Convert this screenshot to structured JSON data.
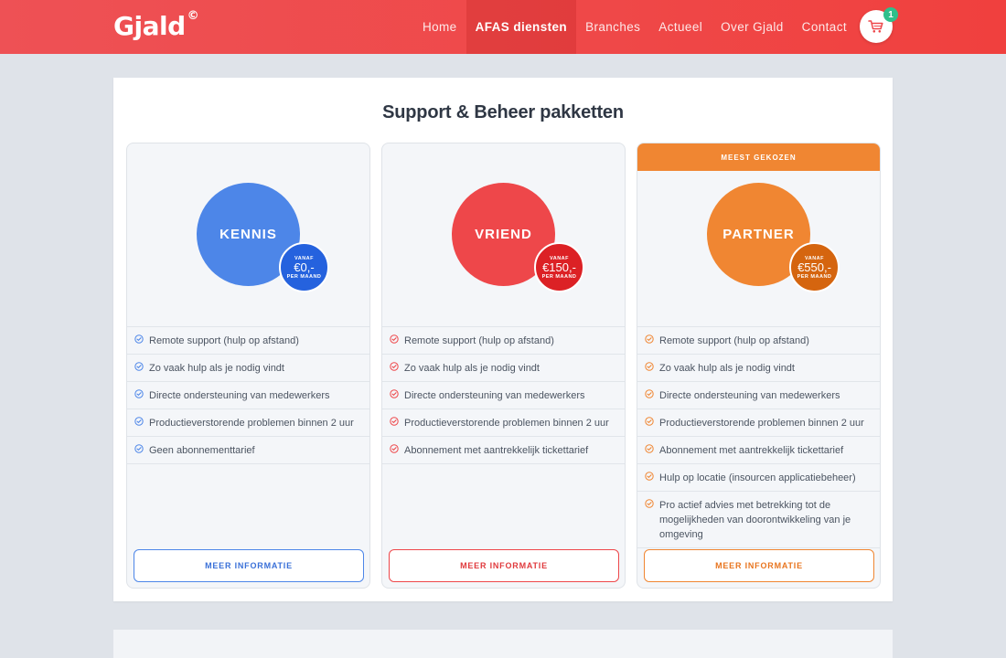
{
  "header": {
    "logo": "Gjald",
    "logo_mark": "©",
    "nav": [
      "Home",
      "AFAS diensten",
      "Branches",
      "Actueel",
      "Over Gjald",
      "Contact"
    ],
    "active_nav": "AFAS diensten",
    "cart_count": "1"
  },
  "section": {
    "title": "Support & Beheer pakketten"
  },
  "plans": [
    {
      "name": "KENNIS",
      "vanaf": "VANAF",
      "price": "€0,-",
      "per": "PER MAAND",
      "accent": "#4d86e8",
      "features": [
        "Remote support (hulp op afstand)",
        "Zo vaak hulp als je nodig vindt",
        "Directe ondersteuning van medewerkers",
        "Productieverstorende problemen binnen 2 uur",
        "Geen abonnementtarief"
      ],
      "button": "MEER INFORMATIE"
    },
    {
      "name": "VRIEND",
      "vanaf": "VANAF",
      "price": "€150,-",
      "per": "PER MAAND",
      "accent": "#ee474a",
      "features": [
        "Remote support (hulp op afstand)",
        "Zo vaak hulp als je nodig vindt",
        "Directe ondersteuning van medewerkers",
        "Productieverstorende problemen binnen 2 uur",
        "Abonnement met aantrekkelijk tickettarief"
      ],
      "button": "MEER INFORMATIE"
    },
    {
      "ribbon": "MEEST GEKOZEN",
      "name": "PARTNER",
      "vanaf": "VANAF",
      "price": "€550,-",
      "per": "PER MAAND",
      "accent": "#f08632",
      "features": [
        "Remote support (hulp op afstand)",
        "Zo vaak hulp als je nodig vindt",
        "Directe ondersteuning van medewerkers",
        "Productieverstorende problemen binnen 2 uur",
        "Abonnement met aantrekkelijk tickettarief",
        "Hulp op locatie (insourcen applicatiebeheer)",
        "Pro actief advies met betrekking tot de mogelijkheden van doorontwikkeling van je omgeving"
      ],
      "button": "MEER INFORMATIE"
    }
  ]
}
